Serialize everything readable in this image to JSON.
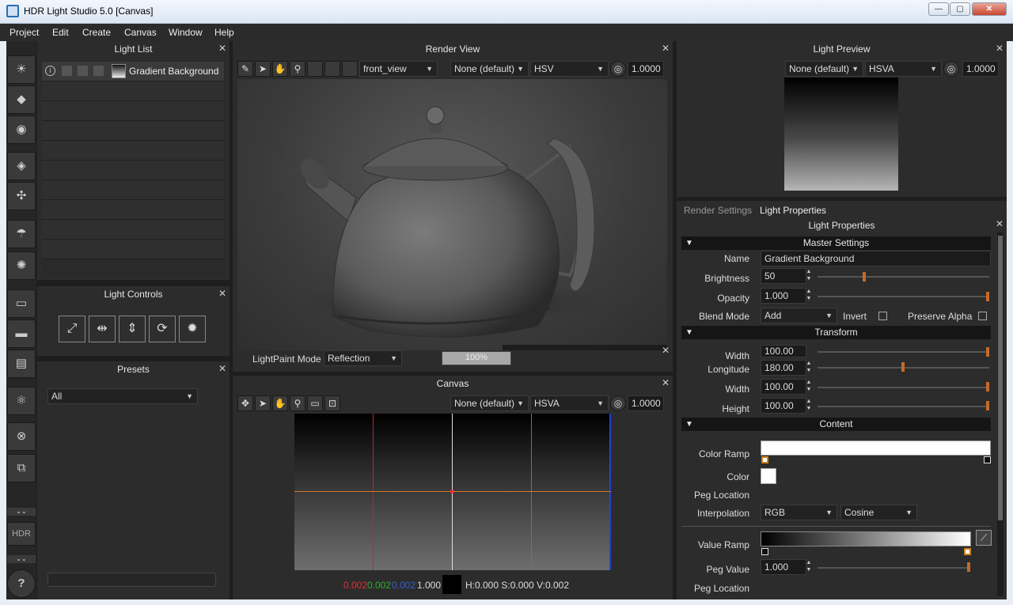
{
  "window": {
    "title": "HDR Light Studio 5.0 [Canvas]",
    "min": "—",
    "max": "▢",
    "close": "✕"
  },
  "menu": [
    "Project",
    "Edit",
    "Create",
    "Canvas",
    "Window",
    "Help"
  ],
  "light_list": {
    "title": "Light List",
    "items": [
      {
        "name": "Gradient Background"
      }
    ]
  },
  "light_controls": {
    "title": "Light Controls"
  },
  "presets": {
    "title": "Presets",
    "filter": "All"
  },
  "render_view": {
    "title": "Render View",
    "camera": "front_view",
    "lut": "None (default)",
    "color_mode": "HSV",
    "exposure": "1.0000",
    "lightpaint_label": "LightPaint Mode",
    "lightpaint_mode": "Reflection",
    "progress_text": "100%",
    "progress": 1.0
  },
  "canvas": {
    "title": "Canvas",
    "lut": "None (default)",
    "color_mode": "HSVA",
    "exposure": "1.0000",
    "readout": {
      "r": "0.002",
      "g": "0.002",
      "b": "0.002",
      "a": "1.000",
      "hsv": "H:0.000 S:0.000 V:0.002"
    },
    "colors": {
      "red_line": "#cc2222",
      "green_line": "#22aa22",
      "blue_line": "#2244cc",
      "orange_line": "#d27a2a"
    }
  },
  "light_preview": {
    "title": "Light Preview",
    "lut": "None (default)",
    "color_mode": "HSVA",
    "exposure": "1.0000"
  },
  "tabs": {
    "render_settings": "Render Settings",
    "light_properties": "Light Properties"
  },
  "props": {
    "title": "Light Properties",
    "master": {
      "header": "Master Settings",
      "name_label": "Name",
      "name_value": "Gradient Background",
      "brightness_label": "Brightness",
      "brightness_value": "50",
      "brightness_level": 0.27,
      "opacity_label": "Opacity",
      "opacity_value": "1.000",
      "opacity_level": 1.0,
      "blend_label": "Blend Mode",
      "blend_value": "Add",
      "invert_label": "Invert",
      "preserve_alpha_label": "Preserve Alpha"
    },
    "transform": {
      "header": "Transform",
      "width1_label": "Width",
      "width1_value": "100.00",
      "longitude_label": "Longitude",
      "longitude_value": "180.00",
      "width2_label": "Width",
      "width2_value": "100.00",
      "height_label": "Height",
      "height_value": "100.00"
    },
    "content": {
      "header": "Content",
      "color_ramp_label": "Color Ramp",
      "color_label": "Color",
      "peg_location_label": "Peg Location",
      "interp_label": "Interpolation",
      "interp_space": "RGB",
      "interp_type": "Cosine",
      "value_ramp_label": "Value Ramp",
      "peg_value_label": "Peg Value",
      "peg_value": "1.000",
      "peg_location2_label": "Peg Location"
    }
  },
  "sidebar": {
    "hdr_label": "HDR",
    "help": "?"
  }
}
